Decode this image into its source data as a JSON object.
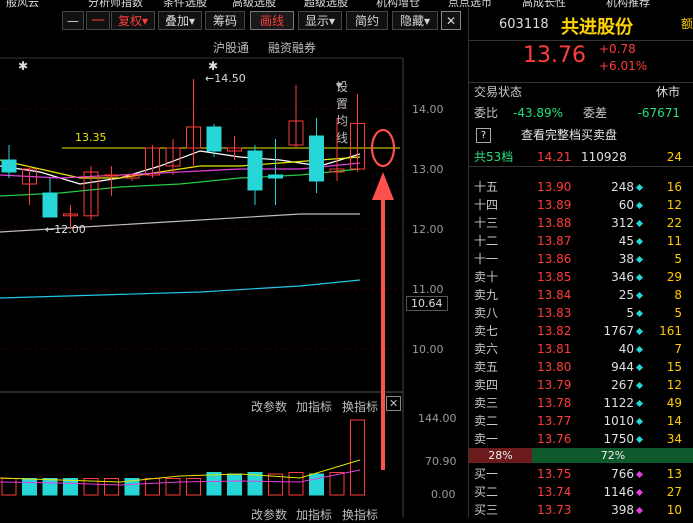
{
  "top_menu": [
    "般风云",
    "分析师指数",
    "条件选股",
    "高级选股",
    "超级选股",
    "机构增仓",
    "点点选币",
    "高成长性",
    "机构推荐"
  ],
  "toolbar": {
    "left_glyph": "—",
    "fuquan": "复权",
    "fuquan_arrow": "▾",
    "overlay": "叠加",
    "overlay_arrow": "▾",
    "chips": "筹码",
    "drawline": "画线",
    "display": "显示",
    "display_arrow": "▾",
    "simple": "简约",
    "hide": "隐藏",
    "hide_arrow": "▾",
    "close": "✕"
  },
  "subbar": {
    "hgt": "沪股通",
    "margin": "融资融券",
    "setma": "设置均线",
    "setma_arrow": "▾"
  },
  "chart_data": {
    "type": "candlestick",
    "yaxis_ticks": [
      "14.00",
      "13.00",
      "12.00",
      "11.00",
      "10.00"
    ],
    "current_price_box": "10.64",
    "annotations": {
      "high": "14.50",
      "low": "12.00",
      "ref_line": "13.35"
    },
    "stars": [
      "✱",
      "✱"
    ],
    "candles": [
      {
        "o": 13.15,
        "h": 13.4,
        "l": 12.85,
        "c": 12.95
      },
      {
        "o": 12.75,
        "h": 13.05,
        "l": 12.4,
        "c": 13.0
      },
      {
        "o": 12.6,
        "h": 12.85,
        "l": 12.2,
        "c": 12.2
      },
      {
        "o": 12.22,
        "h": 12.4,
        "l": 12.0,
        "c": 12.25
      },
      {
        "o": 12.22,
        "h": 13.05,
        "l": 12.15,
        "c": 12.95
      },
      {
        "o": 12.9,
        "h": 13.05,
        "l": 12.55,
        "c": 12.9
      },
      {
        "o": 12.85,
        "h": 12.92,
        "l": 12.8,
        "c": 12.9
      },
      {
        "o": 12.9,
        "h": 13.4,
        "l": 12.85,
        "c": 13.35
      },
      {
        "o": 13.05,
        "h": 13.5,
        "l": 12.9,
        "c": 13.35
      },
      {
        "o": 13.35,
        "h": 14.5,
        "l": 13.05,
        "c": 13.7
      },
      {
        "o": 13.7,
        "h": 13.75,
        "l": 13.2,
        "c": 13.3
      },
      {
        "o": 13.3,
        "h": 13.55,
        "l": 13.15,
        "c": 13.35
      },
      {
        "o": 13.3,
        "h": 13.4,
        "l": 12.4,
        "c": 12.65
      },
      {
        "o": 12.9,
        "h": 13.5,
        "l": 12.4,
        "c": 12.85
      },
      {
        "o": 13.4,
        "h": 14.4,
        "l": 13.35,
        "c": 13.8
      },
      {
        "o": 13.55,
        "h": 13.85,
        "l": 12.6,
        "c": 12.8
      },
      {
        "o": 12.95,
        "h": 13.85,
        "l": 12.8,
        "c": 13.0
      },
      {
        "o": 13.0,
        "h": 14.25,
        "l": 12.95,
        "c": 13.76
      }
    ],
    "volume": {
      "labels": {
        "y_top": "144.00",
        "y_mid": "70.90",
        "y_zero": "0.00"
      },
      "bars": [
        22,
        22,
        22,
        22,
        22,
        22,
        22,
        22,
        22,
        22,
        30,
        28,
        30,
        28,
        30,
        28,
        30,
        100
      ],
      "colors": [
        "up",
        "dn",
        "dn",
        "dn",
        "up",
        "up",
        "dn",
        "up",
        "up",
        "up",
        "dn",
        "dn",
        "dn",
        "up",
        "up",
        "dn",
        "up",
        "up"
      ]
    }
  },
  "indicator_bar": {
    "change_param": "改参数",
    "add_indicator": "加指标",
    "switch_indicator": "换指标",
    "close": "✕"
  },
  "stock": {
    "code": "603118",
    "name": "共进股份",
    "price": "13.76",
    "change": "+0.78",
    "pct": "+6.01%",
    "trade_status_label": "交易状态",
    "trade_status": "休市",
    "webi_label": "委比",
    "webi": "-43.89%",
    "weicha_label": "委差",
    "weicha": "-67671",
    "full_book": "查看完整档买卖盘",
    "help_icon": "?",
    "levels_label": "共53档",
    "levels_price": "14.21",
    "levels_vol": "110928",
    "levels_cnt": "24",
    "asks": [
      {
        "label": "十五",
        "price": "13.90",
        "vol": "248",
        "cnt": "16"
      },
      {
        "label": "十四",
        "price": "13.89",
        "vol": "60",
        "cnt": "12"
      },
      {
        "label": "十三",
        "price": "13.88",
        "vol": "312",
        "cnt": "22"
      },
      {
        "label": "十二",
        "price": "13.87",
        "vol": "45",
        "cnt": "11"
      },
      {
        "label": "十一",
        "price": "13.86",
        "vol": "38",
        "cnt": "5"
      },
      {
        "label": "卖十",
        "price": "13.85",
        "vol": "346",
        "cnt": "29"
      },
      {
        "label": "卖九",
        "price": "13.84",
        "vol": "25",
        "cnt": "8"
      },
      {
        "label": "卖八",
        "price": "13.83",
        "vol": "5",
        "cnt": "5"
      },
      {
        "label": "卖七",
        "price": "13.82",
        "vol": "1767",
        "cnt": "161"
      },
      {
        "label": "卖六",
        "price": "13.81",
        "vol": "40",
        "cnt": "7"
      },
      {
        "label": "卖五",
        "price": "13.80",
        "vol": "944",
        "cnt": "15"
      },
      {
        "label": "卖四",
        "price": "13.79",
        "vol": "267",
        "cnt": "12"
      },
      {
        "label": "卖三",
        "price": "13.78",
        "vol": "1122",
        "cnt": "49"
      },
      {
        "label": "卖二",
        "price": "13.77",
        "vol": "1010",
        "cnt": "14"
      },
      {
        "label": "卖一",
        "price": "13.76",
        "vol": "1750",
        "cnt": "34"
      }
    ],
    "bar_left": "28%",
    "bar_right": "72%",
    "bids": [
      {
        "label": "买一",
        "price": "13.75",
        "vol": "766",
        "cnt": "13"
      },
      {
        "label": "买二",
        "price": "13.74",
        "vol": "1146",
        "cnt": "27"
      },
      {
        "label": "买三",
        "price": "13.73",
        "vol": "398",
        "cnt": "10"
      }
    ],
    "edge_char": "额"
  },
  "colors": {
    "up": "#ff3b3b",
    "down": "#27d6d6",
    "dot_up": "#22d8d8",
    "dot_down": "#e040e0",
    "accent": "#ff5050"
  }
}
